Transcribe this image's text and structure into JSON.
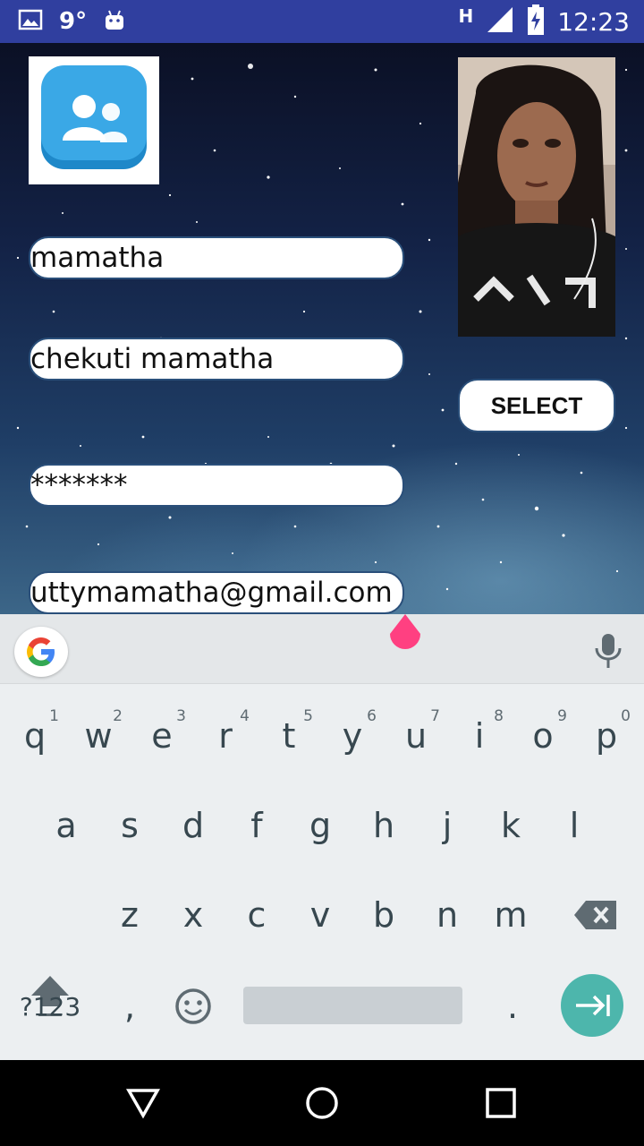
{
  "status_bar": {
    "temperature": "9°",
    "network": "H",
    "time": "12:23",
    "icons": [
      "gallery-icon",
      "android-icon",
      "signal-icon",
      "battery-charging-icon"
    ]
  },
  "form": {
    "first_name": "mamatha",
    "full_name": "chekuti mamatha",
    "password": "*******",
    "email": "uttymamatha@gmail.com",
    "select_button": "SELECT"
  },
  "keyboard": {
    "row1": [
      {
        "k": "q",
        "h": "1"
      },
      {
        "k": "w",
        "h": "2"
      },
      {
        "k": "e",
        "h": "3"
      },
      {
        "k": "r",
        "h": "4"
      },
      {
        "k": "t",
        "h": "5"
      },
      {
        "k": "y",
        "h": "6"
      },
      {
        "k": "u",
        "h": "7"
      },
      {
        "k": "i",
        "h": "8"
      },
      {
        "k": "o",
        "h": "9"
      },
      {
        "k": "p",
        "h": "0"
      }
    ],
    "row2": [
      "a",
      "s",
      "d",
      "f",
      "g",
      "h",
      "j",
      "k",
      "l"
    ],
    "row3": [
      "z",
      "x",
      "c",
      "v",
      "b",
      "n",
      "m"
    ],
    "symbols_key": "?123",
    "comma_key": ",",
    "period_key": "."
  },
  "colors": {
    "status_bar": "#303f9f",
    "enter_key": "#4db6ac",
    "cursor_handle": "#ff4081"
  }
}
